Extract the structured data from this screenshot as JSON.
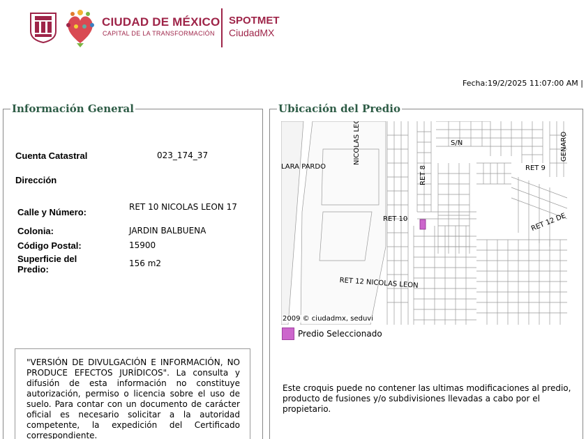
{
  "header": {
    "org_title": "CIUDAD DE MÉXICO",
    "org_subtitle": "CAPITAL DE LA TRANSFORMACIÓN",
    "app_title": "SPOTMET",
    "app_subtitle": "CiudadMX",
    "brand_color": "#9e2448"
  },
  "date_text": "Fecha:19/2/2025 11:07:00 AM |",
  "general": {
    "legend": "Información General",
    "cuenta_label": "Cuenta Catastral",
    "cuenta_value": "023_174_37",
    "direccion_label": "Dirección",
    "fields": [
      {
        "label": "Calle y Número:",
        "value": "RET 10 NICOLAS LEON 17"
      },
      {
        "label": "Colonia:",
        "value": "JARDIN BALBUENA"
      },
      {
        "label": "Código Postal:",
        "value": "15900"
      },
      {
        "label": "Superficie del Predio:",
        "value": "156 m2"
      }
    ],
    "notice": "\"VERSIÓN DE DIVULGACIÓN E INFORMACIÓN, NO PRODUCE EFECTOS JURÍDICOS\". La consulta y difusión de esta información no constituye autorización, permiso o licencia sobre el uso de suelo. Para contar con un documento de carácter oficial es necesario solicitar a la autoridad competente, la expedición del Certificado correspondiente."
  },
  "location": {
    "legend": "Ubicación del Predio",
    "map_labels": {
      "lara_pardo": "LARA PARDO",
      "nicolas_leon_v": "NICOLAS LEON",
      "ret8": "RET 8",
      "sn": "S/N",
      "ret9": "RET 9",
      "genaro": "GENARO",
      "ret10": "RET 10",
      "ret12d": "RET 12 DE",
      "ret12n": "RET 12 NICOLAS LEON"
    },
    "copyright": "2009 © ciudadmx, seduvi",
    "legend_item": "Predio Seleccionado",
    "selected_color": "#cc66cc",
    "disclaimer": "Este croquis puede no contener las ultimas modificaciones al predio, producto de fusiones y/o subdivisiones llevadas a cabo por el propietario."
  }
}
